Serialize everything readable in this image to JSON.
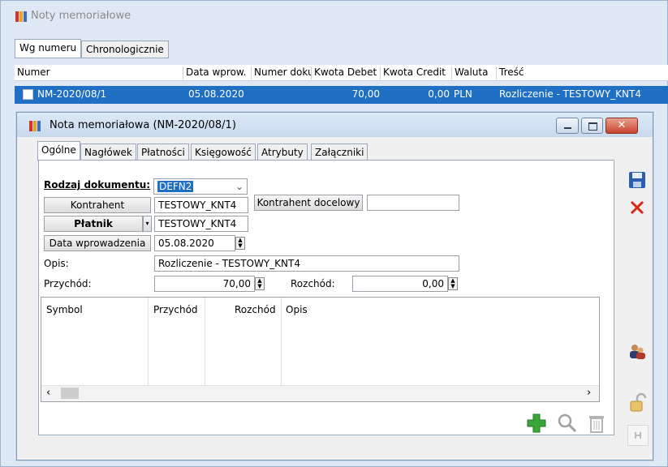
{
  "back_window": {
    "title": "Noty memoriałowe",
    "tabs": [
      {
        "label": "Wg numeru"
      },
      {
        "label": "Chronologicznie"
      }
    ],
    "columns": [
      "Numer",
      "Data wprow.",
      "Numer doku",
      "Kwota Debet",
      "Kwota Credit",
      "Waluta",
      "Treść"
    ],
    "rows": [
      {
        "numer": "NM-2020/08/1",
        "data": "05.08.2020",
        "numer_dok": "",
        "debet": "70,00",
        "credit": "0,00",
        "waluta": "PLN",
        "tresc": "Rozliczenie - TESTOWY_KNT4"
      }
    ]
  },
  "dialog": {
    "title": "Nota memoriałowa (NM-2020/08/1)",
    "tabs": [
      {
        "label": "Ogólne"
      },
      {
        "label": "Nagłówek"
      },
      {
        "label": "Płatności"
      },
      {
        "label": "Księgowość"
      },
      {
        "label": "Atrybuty"
      },
      {
        "label": "Załączniki"
      }
    ],
    "form": {
      "rodzaj_label": "Rodzaj dokumentu:",
      "rodzaj_value": "DEFN2",
      "kontrahent_btn": "Kontrahent",
      "kontrahent_value": "TESTOWY_KNT4",
      "kontrahent_docelowy_btn": "Kontrahent docelowy",
      "kontrahent_docelowy_value": "",
      "platnik_btn": "Płatnik",
      "platnik_value": "TESTOWY_KNT4",
      "data_btn": "Data wprowadzenia",
      "data_value": "05.08.2020",
      "opis_label": "Opis:",
      "opis_value": "Rozliczenie - TESTOWY_KNT4",
      "przychod_label": "Przychód:",
      "przychod_value": "70,00",
      "rozchod_label": "Rozchód:",
      "rozchod_value": "0,00"
    },
    "grid": {
      "columns": [
        "Symbol",
        "Przychód",
        "Rozchód",
        "Opis"
      ]
    }
  },
  "icons": [
    "app-icon",
    "save-icon",
    "delete-icon",
    "users-icon",
    "lock-icon",
    "pin-icon",
    "add-icon",
    "search-icon",
    "trash-icon"
  ],
  "colors": {
    "selection": "#1f6fc5",
    "save": "#2a5fb0",
    "delete": "#d62a1e",
    "add": "#3aa63a"
  }
}
